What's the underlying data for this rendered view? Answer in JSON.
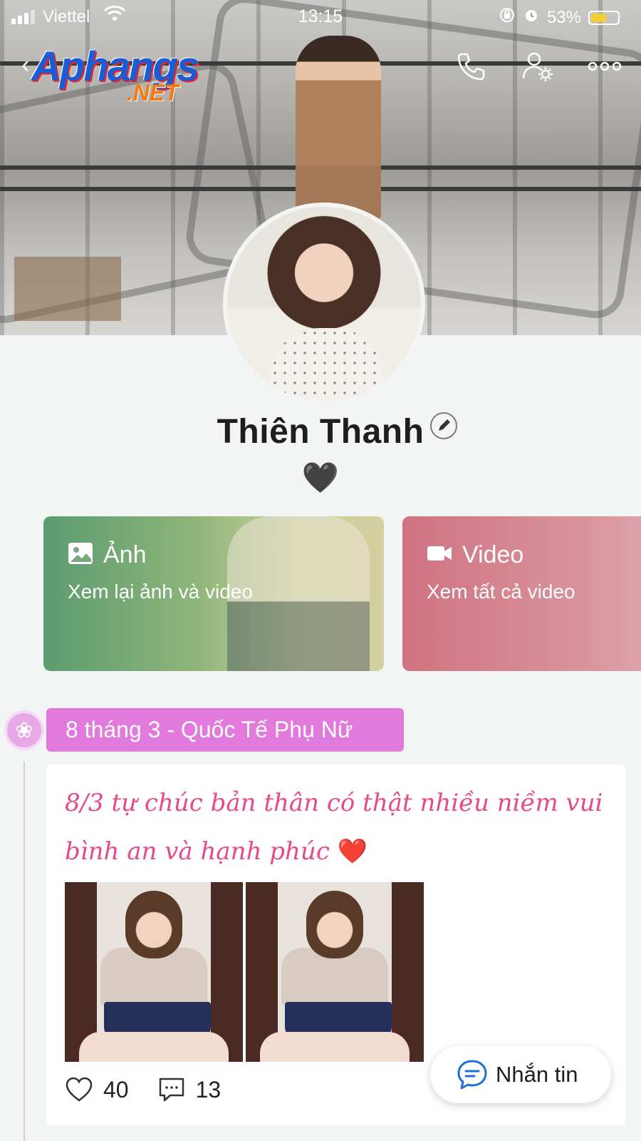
{
  "status_bar": {
    "carrier": "Viettel",
    "time": "13:15",
    "battery": "53%"
  },
  "header": {
    "logo_main": "Aphangs",
    "logo_sub": ".NET",
    "icons": [
      "back-icon",
      "phone-icon",
      "user-settings-icon",
      "more-icon"
    ]
  },
  "profile": {
    "name": "Thiên Thanh",
    "status_emoji": "🖤"
  },
  "cards": [
    {
      "icon": "image-icon",
      "title": "Ảnh",
      "subtitle": "Xem lại ảnh và video",
      "color": "#5c9c70"
    },
    {
      "icon": "video-icon",
      "title": "Video",
      "subtitle": "Xem tất cả video",
      "color": "#d07381"
    }
  ],
  "timeline": {
    "tag_label": "8 tháng 3 - Quốc Tế Phụ Nữ",
    "tag_color": "#e279dd",
    "post": {
      "text": "8/3 tự chúc bản thân có thật nhiều niềm vui bình an và hạnh phúc",
      "text_emoji": "❤️",
      "text_color": "#e8488a",
      "likes": "40",
      "comments": "13"
    }
  },
  "message_button": {
    "label": "Nhắn tin"
  }
}
